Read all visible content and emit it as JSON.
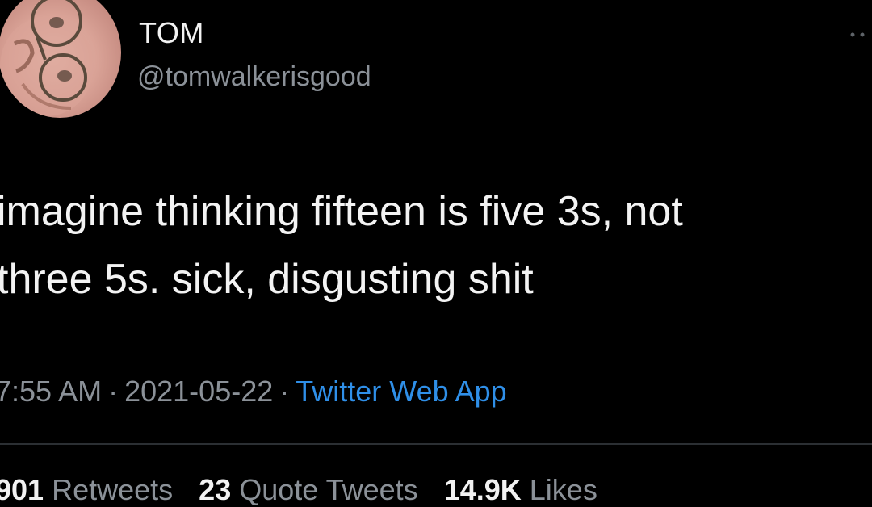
{
  "author": {
    "name": "TOM",
    "handle": "@tomwalkerisgood",
    "avatar_icon": "profile-photo-glasses-icon"
  },
  "tweet": {
    "lines": [
      "imagine thinking fifteen is five 3s, not",
      "three 5s. sick, disgusting shit"
    ]
  },
  "meta": {
    "time": "7:55 AM",
    "separator": "·",
    "date": "2021-05-22",
    "source": "Twitter Web App"
  },
  "stats": {
    "retweets_count": "901",
    "retweets_label": "Retweets",
    "quotes_count": "23",
    "quotes_label": "Quote Tweets",
    "likes_count": "14.9K",
    "likes_label": "Likes"
  },
  "colors": {
    "background": "#000000",
    "primary_text": "#f3f3f3",
    "secondary_text": "#8b9198",
    "link": "#2f8fe8",
    "divider": "#2b2f33"
  },
  "icons": {
    "more": "more-options-icon"
  }
}
